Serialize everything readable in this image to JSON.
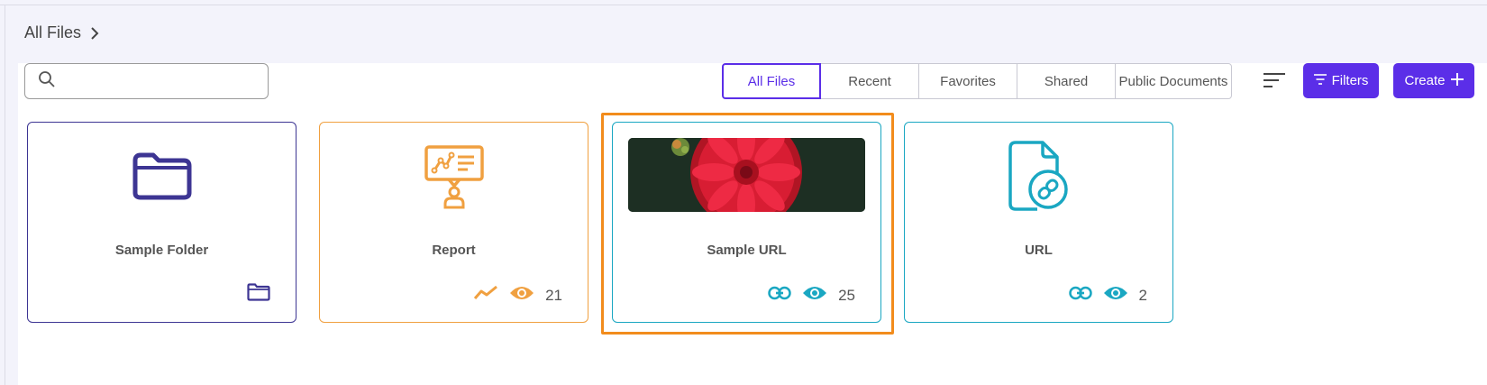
{
  "breadcrumb": {
    "label": "All Files"
  },
  "search": {
    "value": "",
    "placeholder": ""
  },
  "tabs": [
    {
      "label": "All Files",
      "active": true
    },
    {
      "label": "Recent",
      "active": false
    },
    {
      "label": "Favorites",
      "active": false
    },
    {
      "label": "Shared",
      "active": false
    },
    {
      "label": "Public Documents",
      "active": false
    }
  ],
  "toolbar": {
    "filters_label": "Filters",
    "create_label": "Create"
  },
  "cards": [
    {
      "title": "Sample Folder",
      "type": "folder",
      "icon": "folder-icon",
      "color": "#3d3593"
    },
    {
      "title": "Report",
      "type": "report",
      "icon": "report-icon",
      "views": "21",
      "color": "#f0a040"
    },
    {
      "title": "Sample URL",
      "type": "url",
      "icon": "image-thumbnail",
      "views": "25",
      "color": "#1aa7c2",
      "selected": true
    },
    {
      "title": "URL",
      "type": "url",
      "icon": "file-link-icon",
      "views": "2",
      "color": "#1aa7c2"
    }
  ],
  "colors": {
    "accent": "#5b2ee8",
    "selection": "#f28c1c"
  }
}
